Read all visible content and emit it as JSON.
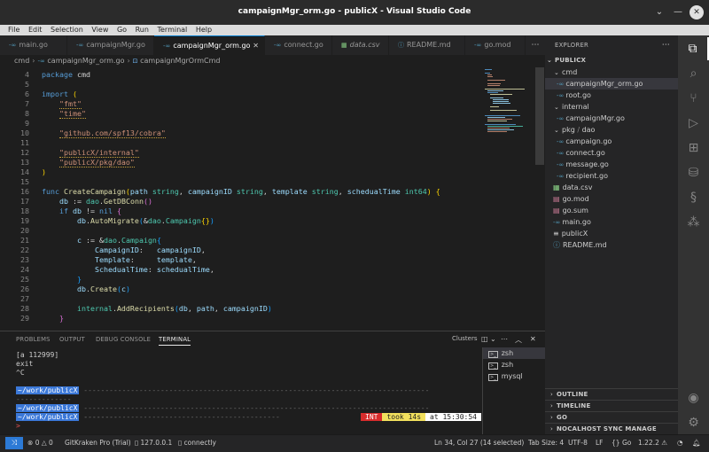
{
  "window": {
    "title": "campaignMgr_orm.go - publicX - Visual Studio Code",
    "controls": [
      "chevron-down",
      "minimize",
      "close"
    ]
  },
  "menu": {
    "items": [
      {
        "label": "File"
      },
      {
        "label": "Edit"
      },
      {
        "label": "Selection"
      },
      {
        "label": "View"
      },
      {
        "label": "Go"
      },
      {
        "label": "Run"
      },
      {
        "label": "Terminal"
      },
      {
        "label": "Help"
      }
    ]
  },
  "tabs": [
    {
      "label": "main.go",
      "icon": "go-icon"
    },
    {
      "label": "campaignMgr.go",
      "icon": "go-icon"
    },
    {
      "label": "campaignMgr_orm.go",
      "icon": "go-icon",
      "active": true
    },
    {
      "label": "connect.go",
      "icon": "go-icon"
    },
    {
      "label": "data.csv",
      "icon": "table-icon"
    },
    {
      "label": "README.md",
      "icon": "info-icon"
    },
    {
      "label": "go.mod",
      "icon": "go-icon"
    }
  ],
  "breadcrumb": {
    "root": "cmd",
    "file": "campaignMgr_orm.go",
    "symbol": "campaignMgrOrmCmd"
  },
  "code": {
    "lines": [
      {
        "n": "4"
      },
      {
        "n": "5"
      },
      {
        "n": "6"
      },
      {
        "n": "7"
      },
      {
        "n": "8"
      },
      {
        "n": "9"
      },
      {
        "n": "10"
      },
      {
        "n": "11"
      },
      {
        "n": "12"
      },
      {
        "n": "13"
      },
      {
        "n": "14"
      },
      {
        "n": "15"
      },
      {
        "n": "16"
      },
      {
        "n": "17"
      },
      {
        "n": "18"
      },
      {
        "n": "19"
      },
      {
        "n": "20"
      },
      {
        "n": "21"
      },
      {
        "n": "22"
      },
      {
        "n": "23"
      },
      {
        "n": "24"
      },
      {
        "n": "25"
      },
      {
        "n": "26"
      },
      {
        "n": "27"
      },
      {
        "n": "28"
      },
      {
        "n": "29"
      }
    ]
  },
  "panel": {
    "tabs": [
      "PROBLEMS",
      "OUTPUT",
      "DEBUG CONSOLE",
      "TERMINAL"
    ],
    "clusters_label": "Clusters",
    "terminal": {
      "lines": [
        "[a 112999]",
        "exit",
        "^C"
      ],
      "prompt_path": "~/work/publicX",
      "status_int": "INT",
      "status_took": "took 14s",
      "status_at": "at 15:30:54",
      "prompt_char": ">"
    },
    "terminal_list": [
      "zsh",
      "zsh",
      "mysql"
    ]
  },
  "explorer": {
    "header": "EXPLORER",
    "root": "PUBLICX",
    "items": [
      {
        "label": "cmd",
        "type": "folder"
      },
      {
        "label": "campaignMgr_orm.go",
        "type": "go",
        "selected": true
      },
      {
        "label": "root.go",
        "type": "go"
      },
      {
        "label": "internal",
        "type": "folder"
      },
      {
        "label": "campaignMgr.go",
        "type": "go"
      },
      {
        "label": "pkg",
        "type": "folder",
        "sub": "dao"
      },
      {
        "label": "campaign.go",
        "type": "go"
      },
      {
        "label": "connect.go",
        "type": "go"
      },
      {
        "label": "message.go",
        "type": "go"
      },
      {
        "label": "recipient.go",
        "type": "go"
      },
      {
        "label": "data.csv",
        "type": "csv"
      },
      {
        "label": "go.mod",
        "type": "mod"
      },
      {
        "label": "go.sum",
        "type": "mod"
      },
      {
        "label": "main.go",
        "type": "go"
      },
      {
        "label": "publicX",
        "type": "bin"
      },
      {
        "label": "README.md",
        "type": "md"
      }
    ],
    "sections": [
      "OUTLINE",
      "TIMELINE",
      "GO",
      "NOCALHOST SYNC MANAGE"
    ]
  },
  "status": {
    "errors": "0",
    "warnings": "0",
    "gitkraken": "GitKraken Pro (Trial)",
    "db": "127.0.0.1",
    "connectly": "connectly",
    "position": "Ln 34, Col 27 (14 selected)",
    "tab_size": "Tab Size: 4",
    "encoding": "UTF-8",
    "eol": "LF",
    "language": "Go",
    "go_version": "1.22.2"
  }
}
